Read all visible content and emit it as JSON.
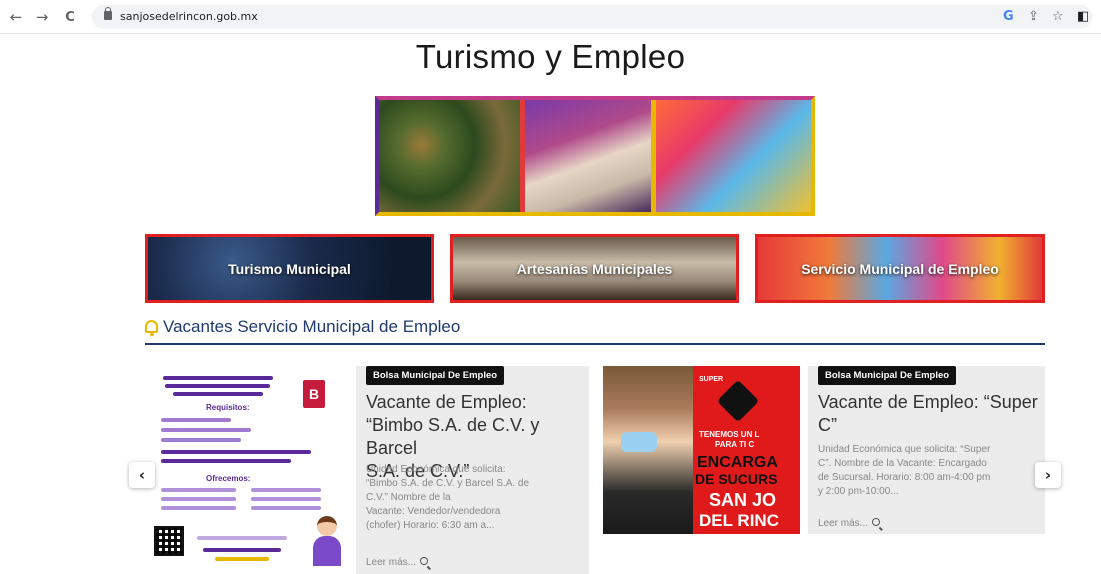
{
  "browser": {
    "back_icon": "←",
    "forward_icon": "→",
    "reload_icon": "C",
    "url": "sanjosedelrincon.gob.mx",
    "google_icon": "G",
    "share_icon": "⇪",
    "star_icon": "☆",
    "sidebar_icon": "◧"
  },
  "page": {
    "title": "Turismo y Empleo"
  },
  "categories": [
    {
      "label": "Turismo Municipal"
    },
    {
      "label": "Artesanías Municipales"
    },
    {
      "label": "Servicio Municipal de Empleo"
    }
  ],
  "section": {
    "title": "Vacantes Servicio Municipal de Empleo"
  },
  "flyer": {
    "heading": "Requisitos:",
    "offer_heading": "Ofrecemos:",
    "logo_letter": "B"
  },
  "cards": [
    {
      "badge": "Bolsa Municipal De Empleo",
      "title_lines": [
        "Vacante de Empleo:",
        "“Bimbo S.A. de C.V. y Barcel",
        "S.A. de C.V.”"
      ],
      "text_lines": [
        "Unidad Económica que solicita:",
        "“Bimbo S.A. de C.V. y Barcel S.A. de",
        "C.V.” Nombre de la",
        "Vacante: Vendedor/vendedora",
        "(chofer) Horario: 6:30 am a..."
      ],
      "read_more": "Leer más..."
    },
    {
      "badge": "Bolsa Municipal De Empleo",
      "title_lines": [
        "Vacante de Empleo: “Super",
        "C”"
      ],
      "text_lines": [
        "Unidad Económica que solicita: “Super",
        "C”. Nombre de la Vacante: Encargado",
        "de Sucursal. Horario: 8:00 am-4:00 pm",
        "y 2:00 pm-10:00..."
      ],
      "read_more": "Leer más..."
    }
  ],
  "card2_image": {
    "brand": "SUPER",
    "line1": "TENEMOS UN L",
    "line2": "PARA TI C",
    "line3": "ENCARGA",
    "line4": "DE SUCURS",
    "line5": "SAN JO",
    "line6": "DEL RINC"
  },
  "carousel": {
    "prev_label": "‹",
    "next_label": "›"
  },
  "colors": {
    "section_blue": "#1f3a6b",
    "banner_red": "#e02020",
    "bell_yellow": "#e6b800"
  }
}
